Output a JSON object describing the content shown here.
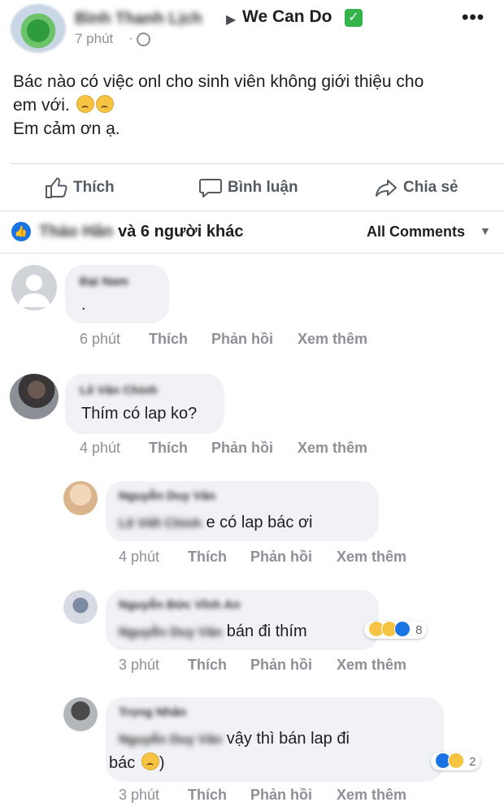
{
  "post": {
    "author_name": "Bình Thanh Lịch",
    "group_name": "We Can Do",
    "time": "7 phút",
    "lines": [
      "Bác nào có việc onl cho sinh viên không giới thiệu cho",
      "em với.",
      "Em cảm ơn ạ."
    ],
    "actions": {
      "like": "Thích",
      "comment": "Bình luận",
      "share": "Chia sẻ"
    },
    "likers_blurred": "Thảo Hân",
    "likers_text": "và 6 người khác",
    "filter": "All Comments"
  },
  "comments": [
    {
      "name": "Đại Nam",
      "text": ".",
      "time": "6 phút",
      "like": "Thích",
      "reply": "Phản hồi",
      "more": "Xem thêm"
    },
    {
      "name": "Lê Văn Chinh",
      "text": "Thím có lap ko?",
      "time": "4 phút",
      "like": "Thích",
      "reply": "Phản hồi",
      "more": "Xem thêm"
    },
    {
      "name": "Nguyễn Duy Văn",
      "mention": "Lê Viết Chinh",
      "text": " e có lap bác ơi",
      "time": "4 phút",
      "like": "Thích",
      "reply": "Phản hồi",
      "more": "Xem thêm"
    },
    {
      "name": "Nguyễn Đức Vĩnh An",
      "mention": "Nguyễn Duy Văn",
      "text": " bán đi thím",
      "reactions": "8",
      "time": "3 phút",
      "like": "Thích",
      "reply": "Phản hồi",
      "more": "Xem thêm"
    },
    {
      "name": "Trọng Nhân",
      "mention": "Nguyễn Duy Văn",
      "text": " vậy thì bán lap đi",
      "text2": "bác",
      "text2_after": ")",
      "reactions": "2",
      "time": "3 phút",
      "like": "Thích",
      "reply": "Phản hồi",
      "more": "Xem thêm"
    }
  ],
  "colors": {
    "like_blue": "#1b74e4",
    "bubble": "#f0f2f5",
    "meta_gray": "#8d9096"
  }
}
